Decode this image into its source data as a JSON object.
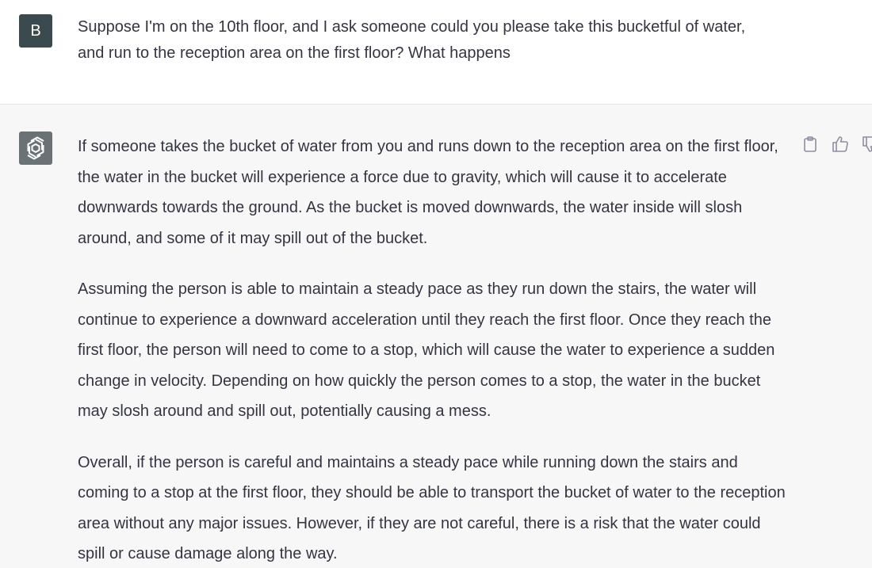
{
  "user": {
    "avatar_initial": "B",
    "message": "Suppose I'm on the 10th floor, and I ask someone  could you please take this bucketful of water, and run to the reception area on the first floor? What happens"
  },
  "assistant": {
    "avatar_icon": "openai-logo-icon",
    "paragraphs": [
      "If someone takes the bucket of water from you and runs down to the reception area on the first floor, the water in the bucket will experience a force due to gravity, which will cause it to accelerate downwards towards the ground. As the bucket is moved downwards, the water inside will slosh around, and some of it may spill out of the bucket.",
      "Assuming the person is able to maintain a steady pace as they run down the stairs, the water will continue to experience a downward acceleration until they reach the first floor. Once they reach the first floor, the person will need to come to a stop, which will cause the water to experience a sudden change in velocity. Depending on how quickly the person comes to a stop, the water in the bucket may slosh around and spill out, potentially causing a mess.",
      "Overall, if the person is careful and maintains a steady pace while running down the stairs and coming to a stop at the first floor, they should be able to transport the bucket of water to the reception area without any major issues. However, if they are not careful, there is a risk that the water could spill or cause damage along the way."
    ],
    "actions": {
      "copy_icon": "clipboard-icon",
      "like_icon": "thumbs-up-icon",
      "dislike_icon": "thumbs-down-icon"
    }
  },
  "colors": {
    "user_bg": "#ffffff",
    "assistant_bg": "#f7f7f8",
    "user_avatar_bg": "#3b4a4e",
    "assistant_avatar_bg": "#6b7275",
    "text": "#343541",
    "icon": "#8e8ea0"
  }
}
